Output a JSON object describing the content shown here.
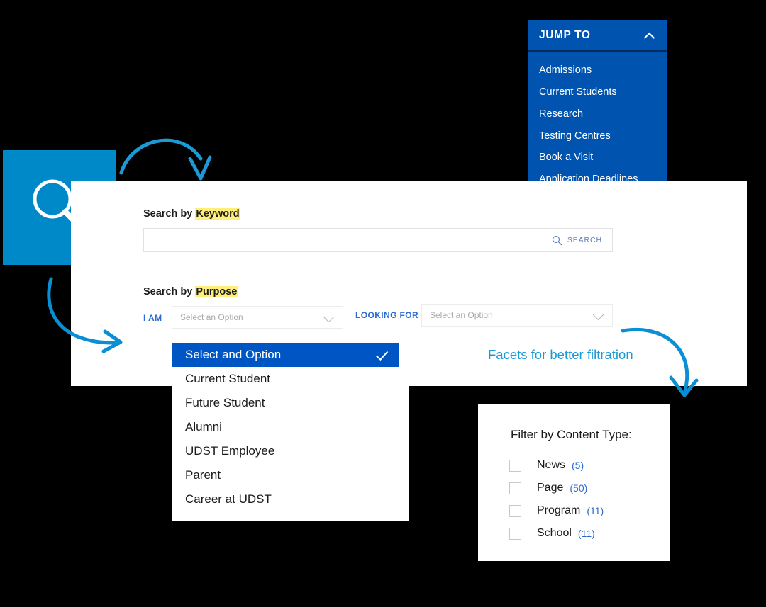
{
  "colors": {
    "background": "#000000",
    "panel_white": "#ffffff",
    "jump_blue": "#0054b0",
    "tile_blue": "#0089c9",
    "accent_blue": "#2a6ad1",
    "annotation_blue": "#1b9ad6",
    "highlight_yellow": "#ffef7a",
    "dropdown_selected": "#0055c4"
  },
  "jump_to": {
    "title": "JUMP TO",
    "collapse_icon": "chevron-up-icon",
    "items": [
      {
        "label": "Admissions"
      },
      {
        "label": "Current Students"
      },
      {
        "label": "Research"
      },
      {
        "label": "Testing Centres"
      },
      {
        "label": "Book a Visit"
      },
      {
        "label": "Application Deadlines"
      }
    ]
  },
  "magnifier_tile": {
    "icon": "magnifier-icon"
  },
  "search_panel": {
    "keyword_section": {
      "label_prefix": "Search by ",
      "label_highlight": "Keyword",
      "input_value": "",
      "input_placeholder": "",
      "search_button_label": "SEARCH",
      "search_button_icon": "search-icon"
    },
    "purpose_section": {
      "label_prefix": "Search by ",
      "label_highlight": "Purpose",
      "i_am_label": "I AM",
      "i_am_value": "Select an Option",
      "looking_for_label": "LOOKING FOR",
      "looking_for_value": "Select an Option",
      "dropdown_icon": "chevron-down-icon"
    }
  },
  "dropdown_menu": {
    "check_icon": "check-icon",
    "options": [
      {
        "label": "Select and Option",
        "selected": true
      },
      {
        "label": "Current Student",
        "selected": false
      },
      {
        "label": "Future Student",
        "selected": false
      },
      {
        "label": "Alumni",
        "selected": false
      },
      {
        "label": "UDST Employee",
        "selected": false
      },
      {
        "label": "Parent",
        "selected": false
      },
      {
        "label": "Career at UDST",
        "selected": false
      }
    ]
  },
  "annotations": {
    "facets_note": "Facets for better filtration",
    "arrow_top": "curved-arrow-icon",
    "arrow_left": "curved-arrow-icon",
    "arrow_right": "curved-arrow-icon"
  },
  "filter_panel": {
    "title": "Filter by Content Type:",
    "items": [
      {
        "label": "News",
        "count": "(5)",
        "checked": false
      },
      {
        "label": "Page",
        "count": "(50)",
        "checked": false
      },
      {
        "label": "Program",
        "count": "(11)",
        "checked": false
      },
      {
        "label": "School",
        "count": "(11)",
        "checked": false
      }
    ]
  }
}
